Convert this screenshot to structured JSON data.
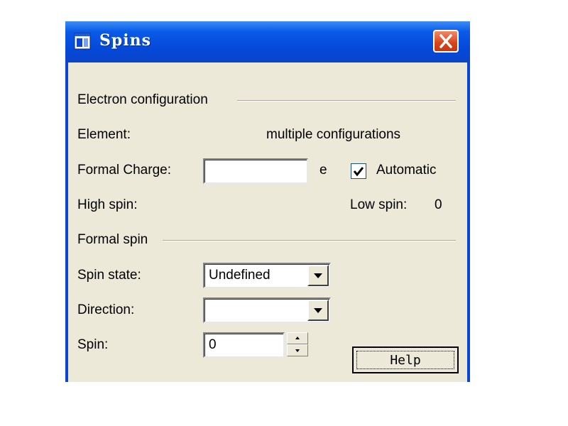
{
  "window": {
    "title": "Spins"
  },
  "electron_configuration": {
    "group_label": "Electron configuration",
    "element_label": "Element:",
    "element_value": "multiple configurations",
    "formal_charge_label": "Formal Charge:",
    "formal_charge_value": "",
    "formal_charge_unit": "e",
    "automatic_label": "Automatic",
    "automatic_checked": true,
    "high_spin_label": "High spin:",
    "high_spin_value": "",
    "low_spin_label": "Low spin:",
    "low_spin_value": "0"
  },
  "formal_spin": {
    "group_label": "Formal spin",
    "spin_state_label": "Spin state:",
    "spin_state_value": "Undefined",
    "direction_label": "Direction:",
    "direction_value": "",
    "spin_label": "Spin:",
    "spin_value": "0"
  },
  "buttons": {
    "help_label": "Help"
  },
  "colors": {
    "titlebar": "#0a45d8",
    "dialog_bg": "#ece9d8",
    "close_button": "#d8431a"
  }
}
